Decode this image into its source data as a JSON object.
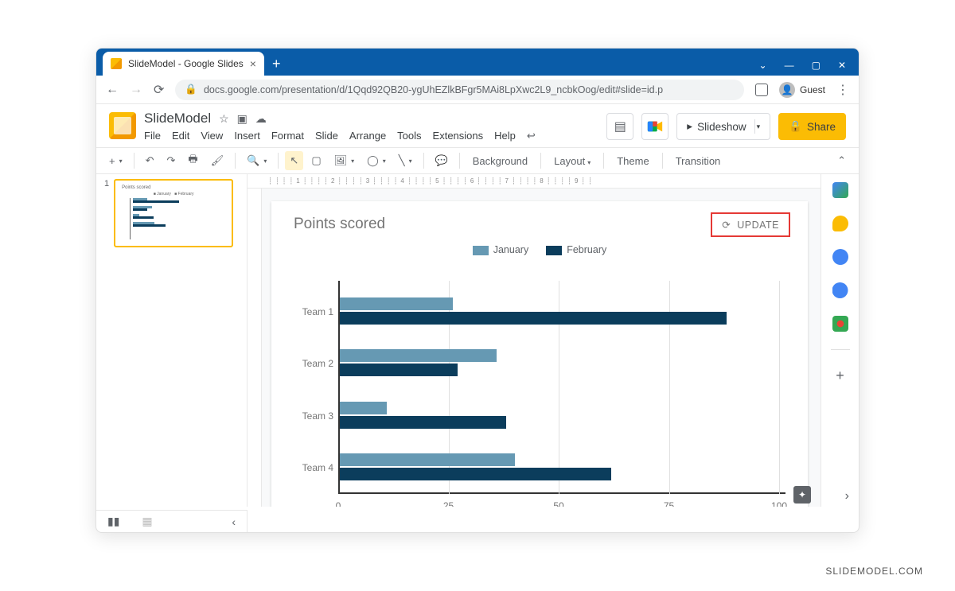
{
  "browser": {
    "tab_title": "SlideModel - Google Slides",
    "url": "docs.google.com/presentation/d/1Qqd92QB20-ygUhEZlkBFgr5MAi8LpXwc2L9_ncbkOog/edit#slide=id.p",
    "guest_label": "Guest"
  },
  "app": {
    "doc_title": "SlideModel",
    "menus": [
      "File",
      "Edit",
      "View",
      "Insert",
      "Format",
      "Slide",
      "Arrange",
      "Tools",
      "Extensions",
      "Help"
    ],
    "slideshow_label": "Slideshow",
    "share_label": "Share"
  },
  "toolbar": {
    "background": "Background",
    "layout": "Layout",
    "theme": "Theme",
    "transition": "Transition"
  },
  "slide": {
    "number": "1",
    "update_label": "UPDATE"
  },
  "chart_data": {
    "type": "bar",
    "orientation": "horizontal",
    "title": "Points scored",
    "categories": [
      "Team 1",
      "Team 2",
      "Team 3",
      "Team 4"
    ],
    "series": [
      {
        "name": "January",
        "color": "#6699b3",
        "values": [
          26,
          36,
          11,
          40
        ]
      },
      {
        "name": "February",
        "color": "#0b3d5c",
        "values": [
          88,
          27,
          38,
          62
        ]
      }
    ],
    "x_ticks": [
      0,
      25,
      50,
      75,
      100
    ],
    "xlim": [
      0,
      100
    ]
  },
  "watermark": "SLIDEMODEL.COM"
}
